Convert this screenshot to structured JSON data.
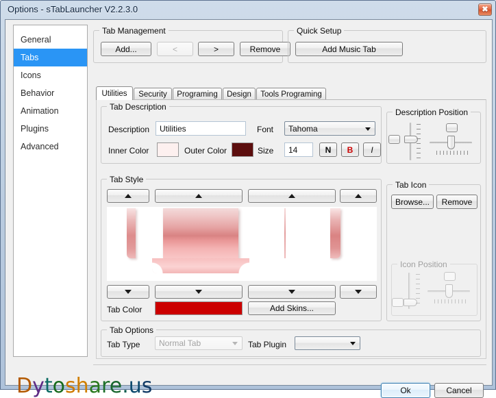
{
  "window": {
    "title": "Options - sTabLauncher V2.2.3.0",
    "close_icon": "close-icon",
    "close_glyph": "✖"
  },
  "sidebar": {
    "items": [
      {
        "label": "General",
        "selected": false
      },
      {
        "label": "Tabs",
        "selected": true
      },
      {
        "label": "Icons",
        "selected": false
      },
      {
        "label": "Behavior",
        "selected": false
      },
      {
        "label": "Animation",
        "selected": false
      },
      {
        "label": "Plugins",
        "selected": false
      },
      {
        "label": "Advanced",
        "selected": false
      }
    ]
  },
  "tab_management": {
    "legend": "Tab Management",
    "add_label": "Add...",
    "prev_label": "<",
    "next_label": ">",
    "remove_label": "Remove"
  },
  "quick_setup": {
    "legend": "Quick Setup",
    "add_music_tab_label": "Add Music Tab"
  },
  "tabs": [
    {
      "label": "Utilities",
      "active": true
    },
    {
      "label": "Security",
      "active": false
    },
    {
      "label": "Programing",
      "active": false
    },
    {
      "label": "Design",
      "active": false
    },
    {
      "label": "Tools Programing",
      "active": false
    }
  ],
  "tab_description": {
    "legend": "Tab Description",
    "description_label": "Description",
    "description_value": "Utilities",
    "font_label": "Font",
    "font_value": "Tahoma",
    "inner_color_label": "Inner Color",
    "inner_color_value": "#fdf0ef",
    "outer_color_label": "Outer Color",
    "outer_color_value": "#5c0e0e",
    "size_label": "Size",
    "size_value": "14",
    "normal_label": "N",
    "bold_label": "B",
    "italic_label": "I",
    "bold_color": "#cc0000"
  },
  "description_position": {
    "legend": "Description Position"
  },
  "tab_style": {
    "legend": "Tab Style",
    "up_arrow_icon": "arrow-up-icon",
    "down_arrow_icon": "arrow-down-icon",
    "tab_color_label": "Tab Color",
    "tab_color_value": "#cc0000",
    "add_skins_label": "Add Skins..."
  },
  "tab_icon": {
    "legend": "Tab Icon",
    "browse_label": "Browse...",
    "remove_label": "Remove"
  },
  "icon_position": {
    "legend": "Icon Position",
    "disabled": true
  },
  "tab_options": {
    "legend": "Tab Options",
    "tab_type_label": "Tab Type",
    "tab_type_value": "Normal Tab",
    "tab_type_disabled": true,
    "tab_plugin_label": "Tab Plugin",
    "tab_plugin_value": ""
  },
  "footer": {
    "watermark": "Dytoshare.us",
    "watermark_letters": [
      {
        "ch": "D",
        "color": "#b35a00"
      },
      {
        "ch": "y",
        "color": "#5e2b85"
      },
      {
        "ch": "t",
        "color": "#0c6b63"
      },
      {
        "ch": "o",
        "color": "#176b1d"
      },
      {
        "ch": "s",
        "color": "#cf7a00"
      },
      {
        "ch": "h",
        "color": "#d07f00"
      },
      {
        "ch": "a",
        "color": "#2a7a1e"
      },
      {
        "ch": "r",
        "color": "#1d6f2a"
      },
      {
        "ch": "e",
        "color": "#18662e"
      },
      {
        "ch": ".",
        "color": "#0d5c4f"
      },
      {
        "ch": "u",
        "color": "#0e4a6e"
      },
      {
        "ch": "s",
        "color": "#123b66"
      }
    ],
    "ok_label": "Ok",
    "cancel_label": "Cancel"
  }
}
